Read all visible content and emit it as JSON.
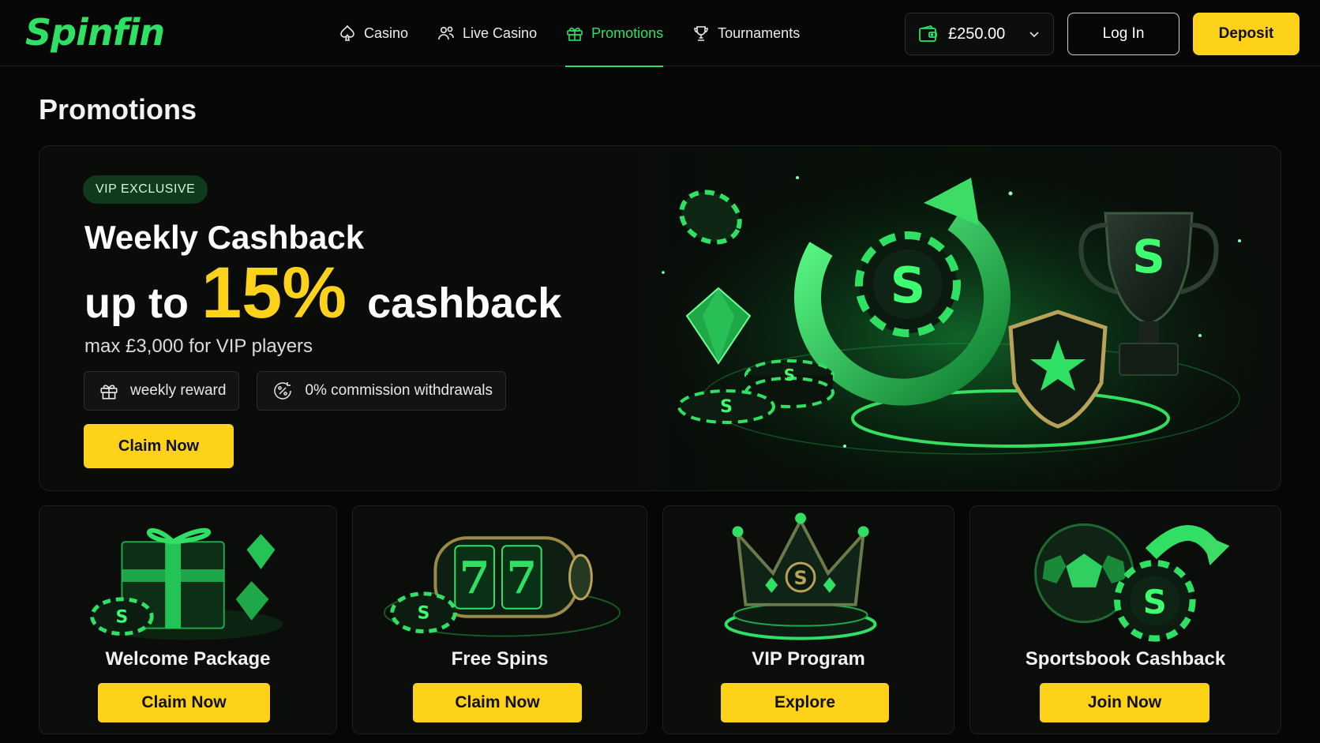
{
  "brand": {
    "name": "Spinfin",
    "accent": "#2fe064",
    "cta_color": "#ffd21a"
  },
  "nav": {
    "items": [
      {
        "label": "Casino",
        "icon": "spade-icon",
        "active": false
      },
      {
        "label": "Live Casino",
        "icon": "users-icon",
        "active": false
      },
      {
        "label": "Promotions",
        "icon": "gift-icon",
        "active": true
      },
      {
        "label": "Tournaments",
        "icon": "trophy-icon",
        "active": false
      }
    ]
  },
  "account": {
    "balance": "£250.00",
    "login_label": "Log In",
    "deposit_label": "Deposit"
  },
  "page": {
    "title": "Promotions"
  },
  "hero": {
    "badge": "VIP EXCLUSIVE",
    "title": "Weekly Cashback",
    "prefix": "up to",
    "percent": "15%",
    "suffix": "cashback",
    "subtitle": "max £3,000 for VIP players",
    "chips": [
      {
        "label": "weekly reward",
        "icon": "gift-icon"
      },
      {
        "label": "0% commission withdrawals",
        "icon": "percent-icon"
      }
    ],
    "cta": "Claim Now"
  },
  "cards": [
    {
      "title": "Welcome Package",
      "cta": "Claim Now",
      "art": "gift-box-art"
    },
    {
      "title": "Free Spins",
      "cta": "Claim Now",
      "art": "slot-reel-art"
    },
    {
      "title": "VIP Program",
      "cta": "Explore",
      "art": "crown-art"
    },
    {
      "title": "Sportsbook Cashback",
      "cta": "Join Now",
      "art": "football-art"
    }
  ]
}
